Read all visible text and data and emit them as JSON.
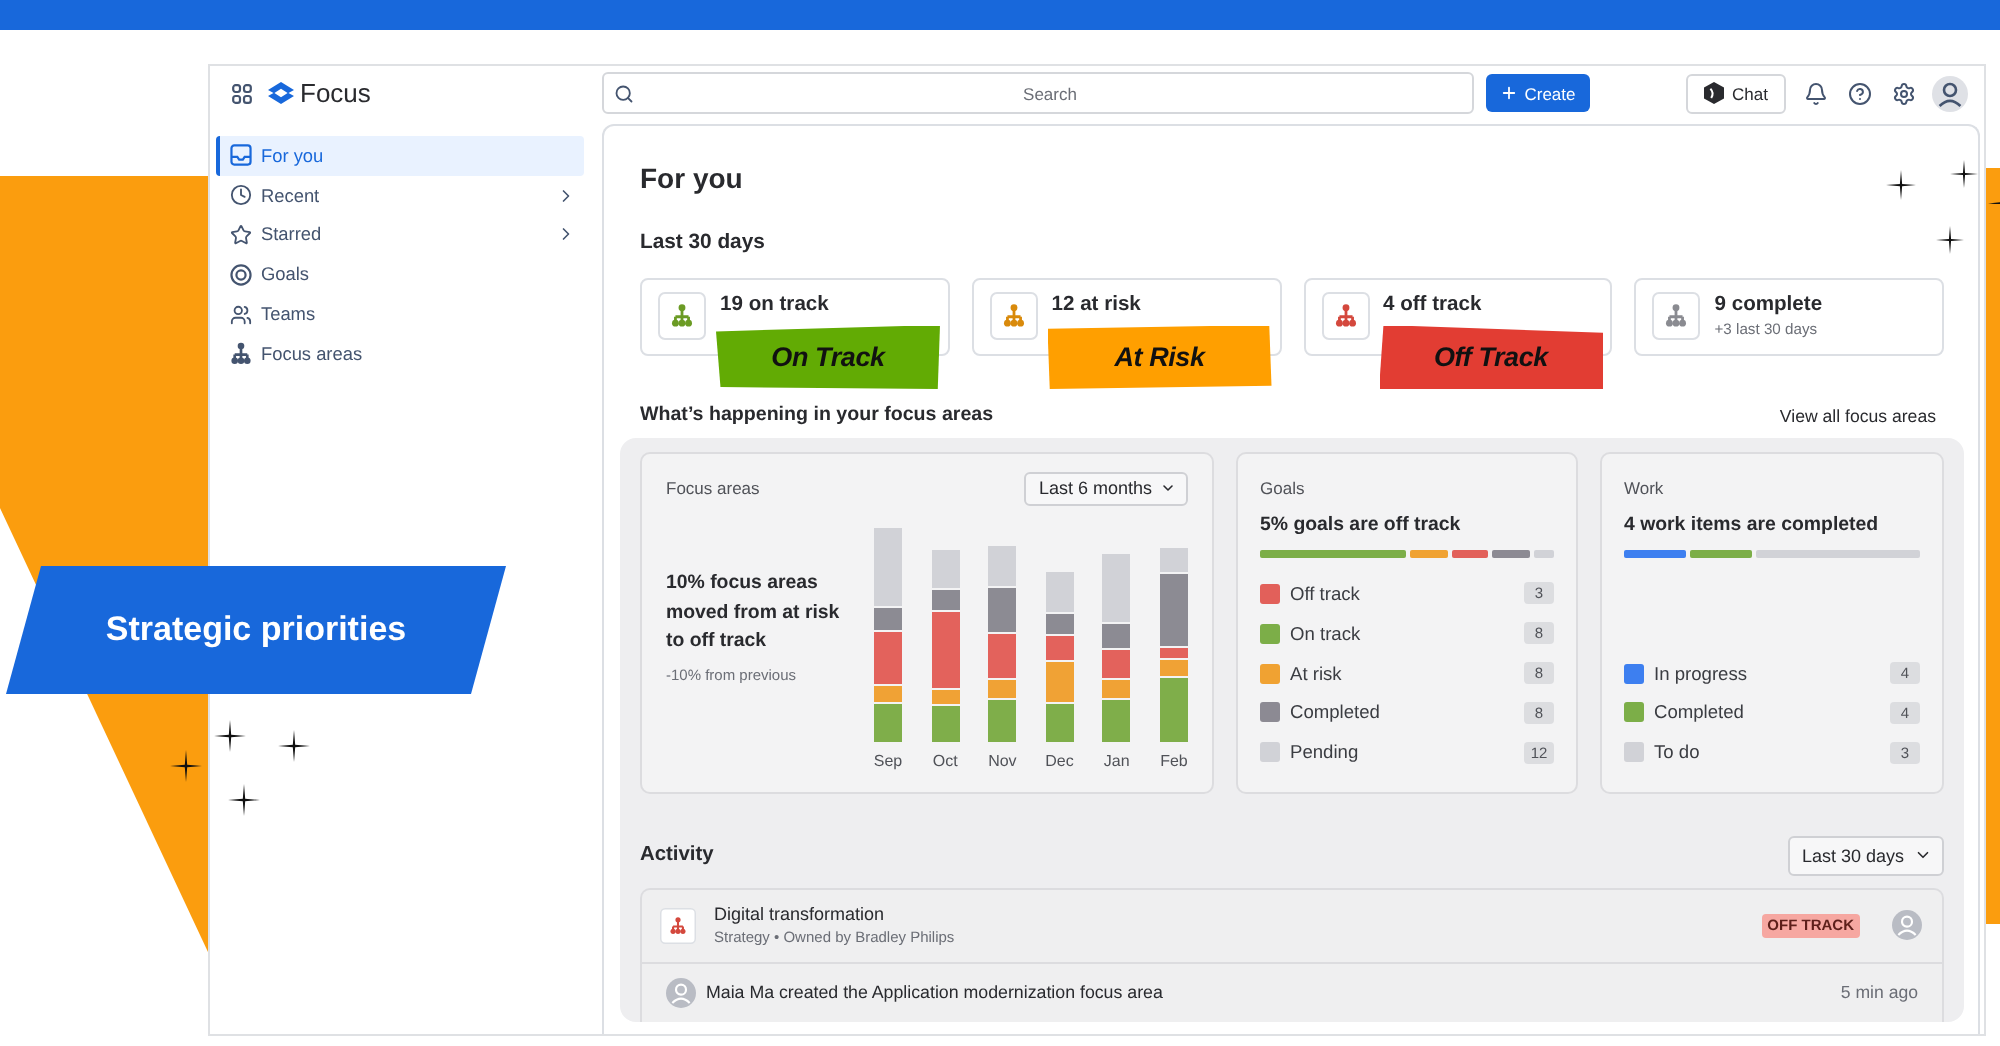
{
  "header": {
    "app_name": "Focus",
    "search": {
      "placeholder": "Search"
    },
    "create_button": "Create",
    "chat_button": "Chat"
  },
  "sidebar": {
    "items": [
      {
        "label": "For you",
        "kind": "link",
        "selected": true
      },
      {
        "label": "Recent",
        "kind": "menu",
        "selected": false
      },
      {
        "label": "Starred",
        "kind": "menu",
        "selected": false
      },
      {
        "label": "Goals",
        "kind": "link",
        "selected": false
      },
      {
        "label": "Teams",
        "kind": "link",
        "selected": false
      },
      {
        "label": "Focus areas",
        "kind": "link",
        "selected": false
      }
    ]
  },
  "page": {
    "title": "For you",
    "period": "Last 30 days",
    "cards": [
      {
        "title": "19 on track",
        "color": "#6b9b24",
        "sticker": {
          "label": "On Track",
          "color": "#62ab04"
        }
      },
      {
        "title": "12 at risk",
        "color": "#d98a0b",
        "sticker": {
          "label": "At Risk",
          "color": "#ff9f00"
        }
      },
      {
        "title": "4 off track",
        "color": "#d4483d",
        "sticker": {
          "label": "Off Track",
          "color": "#e23d33"
        }
      },
      {
        "title": "9 complete",
        "color": "#8a8b91",
        "subtitle": "+3 last 30 days"
      }
    ],
    "section_title": "What’s happening in your focus areas",
    "view_all_link": "View all focus areas"
  },
  "focus_areas_panel": {
    "label": "Focus areas",
    "range": "Last 6 months",
    "headline": "10% focus areas moved from at risk to off track",
    "note": "-10% from previous",
    "months": [
      "Sep",
      "Oct",
      "Nov",
      "Dec",
      "Jan",
      "Feb"
    ]
  },
  "goals_panel": {
    "label": "Goals",
    "headline": "5% goals are off track",
    "legend": [
      {
        "label": "Off track",
        "count": "3",
        "color": "#e2605a"
      },
      {
        "label": "On track",
        "count": "8",
        "color": "#7cae48"
      },
      {
        "label": "At risk",
        "count": "8",
        "color": "#f0a232"
      },
      {
        "label": "Completed",
        "count": "8",
        "color": "#8c8a93"
      },
      {
        "label": "Pending",
        "count": "12",
        "color": "#d1d2d7"
      }
    ]
  },
  "work_panel": {
    "label": "Work",
    "headline": "4 work items are completed",
    "legend": [
      {
        "label": "In progress",
        "count": "4",
        "color": "#3d7ff0"
      },
      {
        "label": "Completed",
        "count": "4",
        "color": "#7cae48"
      },
      {
        "label": "To do",
        "count": "3",
        "color": "#d1d2d7"
      }
    ]
  },
  "activity": {
    "heading": "Activity",
    "range": "Last 30 days",
    "items": [
      {
        "kind": "focus_area",
        "title": "Digital transformation",
        "meta": "Strategy • Owned by Bradley Philips",
        "status": "OFF TRACK"
      },
      {
        "kind": "event",
        "text": "Maia Ma created the Application modernization focus area",
        "time": "5 min ago"
      }
    ]
  },
  "banner": {
    "title": "Strategic priorities"
  }
}
